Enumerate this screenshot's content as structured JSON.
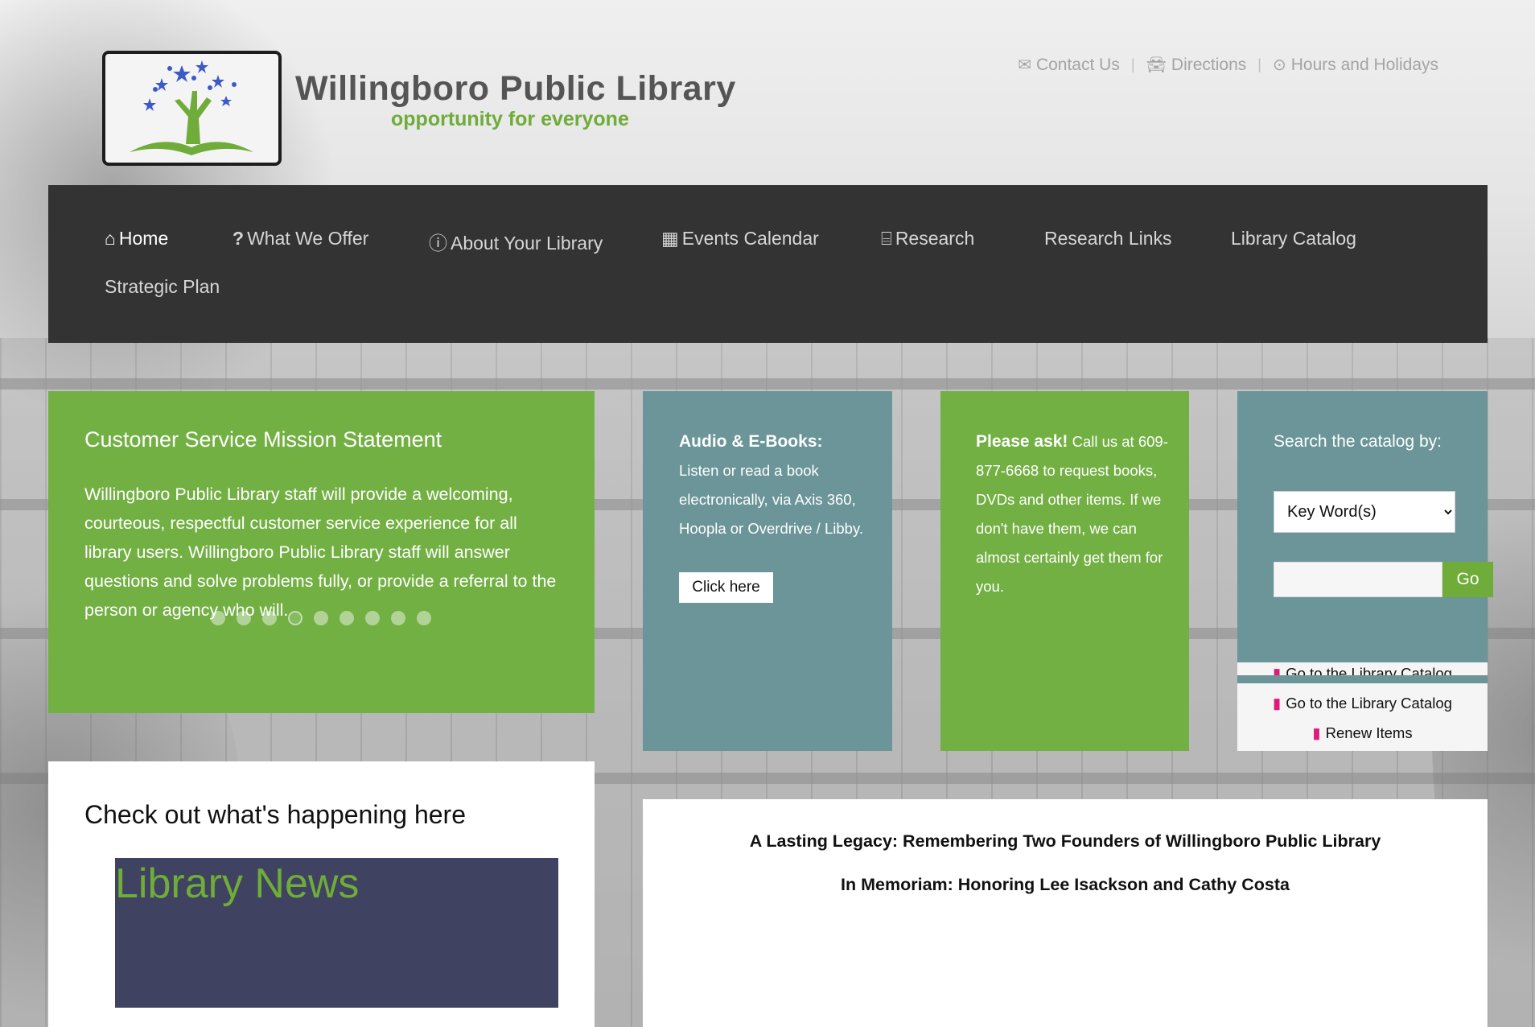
{
  "header": {
    "title": "Willingboro Public Library",
    "tagline": "opportunity for everyone",
    "top_links": [
      {
        "icon": "envelope-icon",
        "label": "Contact Us"
      },
      {
        "icon": "car-icon",
        "label": "Directions"
      },
      {
        "icon": "clock-icon",
        "label": "Hours and Holidays"
      }
    ]
  },
  "nav": {
    "items": [
      {
        "icon": "home-icon",
        "label": "Home",
        "active": true
      },
      {
        "icon": "question-icon",
        "label": "What We Offer"
      },
      {
        "icon": "question-circle-icon",
        "label": "About Your Library"
      },
      {
        "icon": "calendar-icon",
        "label": "Events Calendar"
      },
      {
        "icon": "bank-icon",
        "label": "Research"
      },
      {
        "icon": "",
        "label": "Research Links"
      },
      {
        "icon": "",
        "label": "Library Catalog"
      },
      {
        "icon": "",
        "label": "Strategic Plan"
      }
    ]
  },
  "mission": {
    "heading": "Customer Service Mission Statement",
    "body": "Willingboro Public Library staff will provide a welcoming, courteous, respectful customer service experience for all library users. Willingboro Public Library staff will answer questions and solve problems fully, or provide a referral to the person or agency who will.",
    "slide_count": 9,
    "active_slide": 4
  },
  "ebooks": {
    "heading": "Audio & E-Books:",
    "body": "Listen or read a book electronically, via Axis 360, Hoopla or Overdrive / Libby.",
    "button": "Click here"
  },
  "ask": {
    "heading": "Please ask!",
    "body": "Call us at 609-877-6668 to request books, DVDs and other items. If we don't have them, we can almost certainly get them for you."
  },
  "search": {
    "label": "Search the catalog by:",
    "selected_option": "Key Word(s)",
    "input_value": "",
    "go_button": "Go",
    "links": [
      {
        "icon": "book-icon",
        "label": "Go to the Library Catalog"
      },
      {
        "icon": "book-icon",
        "label": "Go to the Library Catalog"
      },
      {
        "icon": "book-icon",
        "label": "Renew Items"
      }
    ]
  },
  "happening": {
    "heading": "Check out what's happening here",
    "news_title": "Library News"
  },
  "legacy": {
    "line1": "A Lasting Legacy: Remembering Two Founders of Willingboro Public Library",
    "line2": "In Memoriam: Honoring Lee Isackson and Cathy Costa"
  },
  "colors": {
    "green": "#73b043",
    "teal": "#6b9598",
    "nav_bg": "#333333",
    "news_bg": "#3f4260",
    "accent_pink": "#e01a7a"
  }
}
